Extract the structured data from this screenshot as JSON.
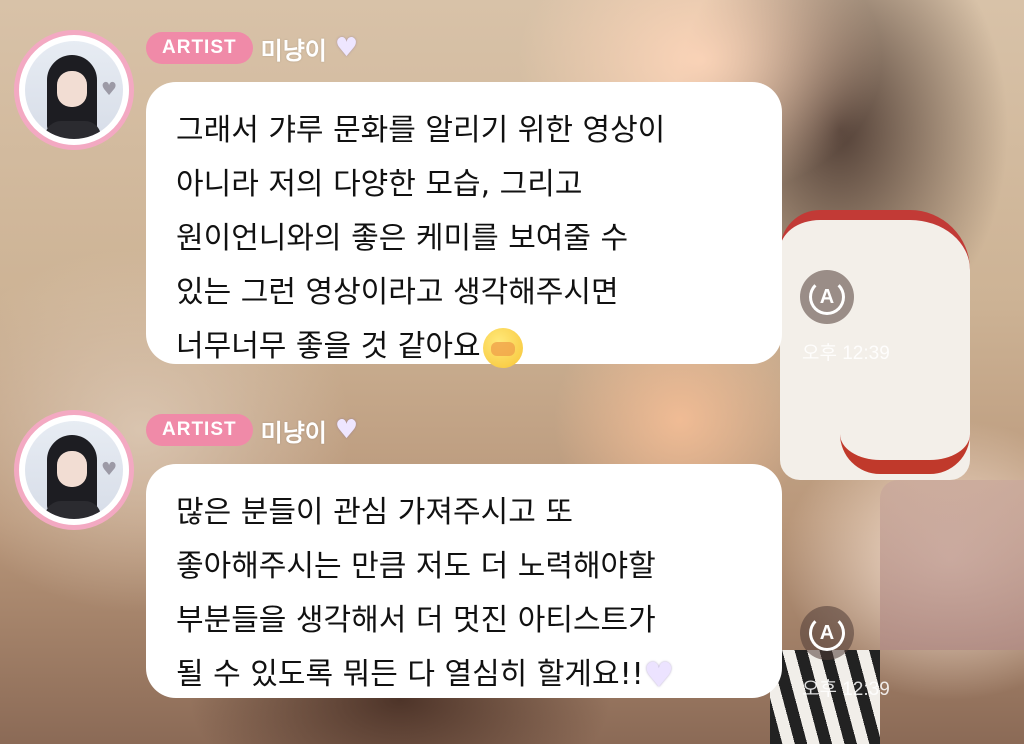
{
  "messages": [
    {
      "badge": "ARTIST",
      "nickname": "미냥이",
      "lines": [
        "그래서 갸루 문화를 알리기 위한 영상이",
        "아니라 저의 다양한 모습, 그리고",
        "원이언니와의 좋은 케미를 보여줄 수",
        "있는 그런 영상이라고 생각해주시면",
        "너무너무 좋을 것 같아요"
      ],
      "time": "오후 12:39",
      "translate_label": "A"
    },
    {
      "badge": "ARTIST",
      "nickname": "미냥이",
      "lines": [
        "많은 분들이 관심 가져주시고 또",
        "좋아해주시는 만큼 저도 더 노력해야할",
        "부분들을 생각해서 더 멋진 아티스트가",
        "될 수 있도록 뭐든 다 열심히 할게요!!"
      ],
      "time": "오후 12:39",
      "translate_label": "A"
    }
  ],
  "icons": {
    "heart": "♡",
    "heart_filled": "🤍"
  },
  "colors": {
    "badge": "#f08aa8",
    "avatar_border": "#f3a9c2",
    "bubble": "#ffffff"
  }
}
